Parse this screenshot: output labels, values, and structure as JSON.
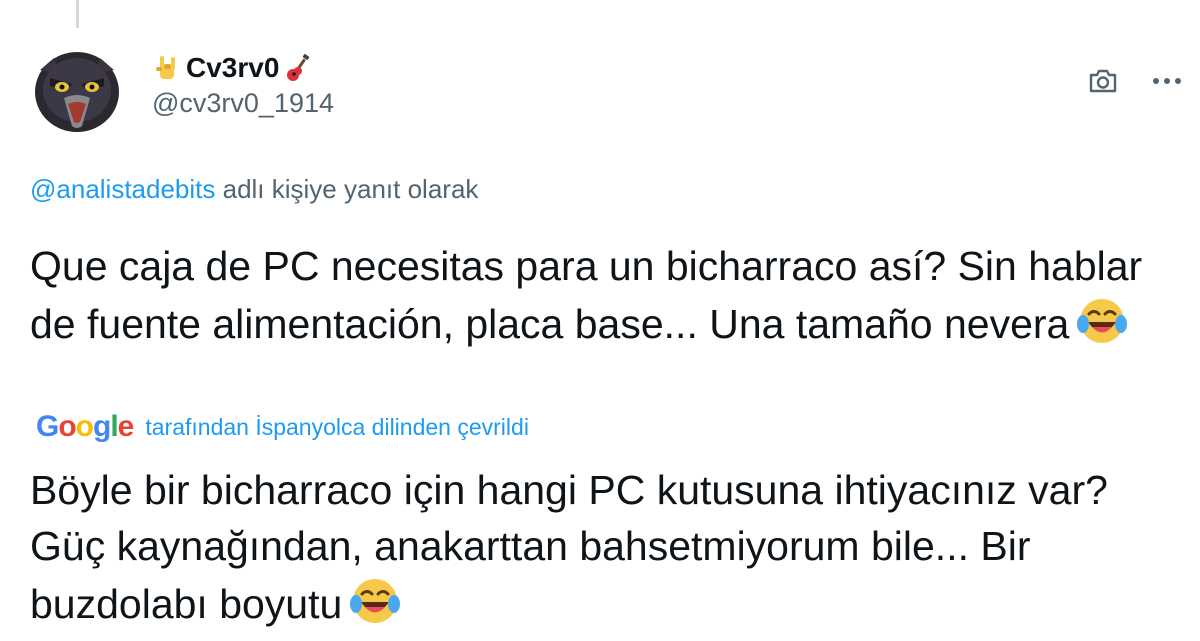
{
  "author": {
    "display_name": "Cv3rv0",
    "handle": "@cv3rv0_1914",
    "name_prefix_icon": "sign-of-horns-icon",
    "name_suffix_icon": "guitar-icon",
    "avatar_icon": "crow-avatar-icon"
  },
  "actions": {
    "camera_icon": "camera-icon",
    "more_icon": "more-icon"
  },
  "reply": {
    "mention": "@analistadebits",
    "suffix": " adlı kişiye yanıt olarak"
  },
  "original": {
    "text": "Que caja de PC necesitas para un bicharraco así? Sin hablar de fuente alimentación, placa base... Una tamaño nevera",
    "emoji_icon": "tears-of-joy-icon"
  },
  "translation": {
    "provider_logo": "Google",
    "label": "tarafından İspanyolca dilinden çevrildi",
    "text": "Böyle bir bicharraco için hangi PC kutusuna ihtiyacınız var? Güç kaynağından, anakarttan bahsetmiyorum bile... Bir buzdolabı boyutu",
    "emoji_icon": "tears-of-joy-icon"
  },
  "colors": {
    "link": "#1d9bf0",
    "secondary_text": "#536471",
    "primary_text": "#0f1419"
  }
}
